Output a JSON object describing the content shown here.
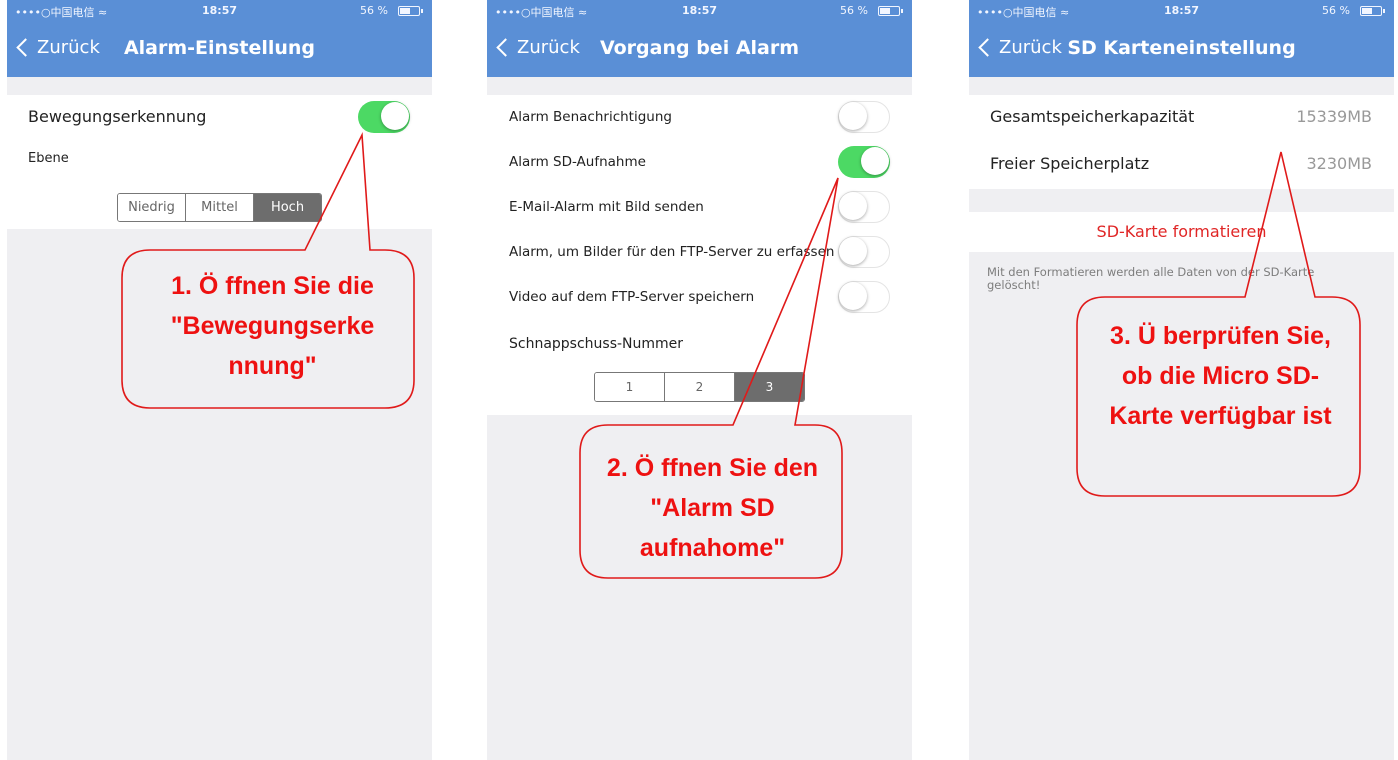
{
  "status": {
    "carrier": "••••○中国电信 ≈",
    "time": "18:57",
    "battery": "56 %"
  },
  "back_label": "Zurück",
  "screen1": {
    "title": "Alarm-Einstellung",
    "motion_label": "Bewegungserkennung",
    "motion_on": true,
    "level_label": "Ebene",
    "levels": [
      "Niedrig",
      "Mittel",
      "Hoch"
    ],
    "level_selected": "Hoch",
    "callout": "1. Ö ffnen Sie die \"Bewegungserke nnung\""
  },
  "screen2": {
    "title": "Vorgang bei Alarm",
    "rows": [
      {
        "label": "Alarm Benachrichtigung",
        "on": false
      },
      {
        "label": "Alarm SD-Aufnahme",
        "on": true
      },
      {
        "label": "E-Mail-Alarm mit Bild senden",
        "on": false
      },
      {
        "label": "Alarm, um Bilder für den FTP-Server zu erfassen",
        "on": false
      },
      {
        "label": "Video auf dem FTP-Server speichern",
        "on": false
      }
    ],
    "snapshot_label": "Schnappschuss-Nummer",
    "snapshot_options": [
      "1",
      "2",
      "3"
    ],
    "snapshot_selected": "3",
    "callout": "2. Ö ffnen Sie den \"Alarm SD aufnahome\""
  },
  "screen3": {
    "title": "SD Karteneinstellung",
    "total_label": "Gesamtspeicherkapazität",
    "total_value": "15339MB",
    "free_label": "Freier Speicherplatz",
    "free_value": "3230MB",
    "format_label": "SD-Karte formatieren",
    "footnote": "Mit den Formatieren werden alle Daten von der SD-Karte gelöscht!",
    "callout": "3. Ü berprüfen Sie, ob die Micro SD-Karte verfügbar ist"
  },
  "colors": {
    "navbar": "#5a8fd6",
    "toggle_on": "#4cd964",
    "callout": "#ee1111",
    "format_link": "#e02626"
  }
}
